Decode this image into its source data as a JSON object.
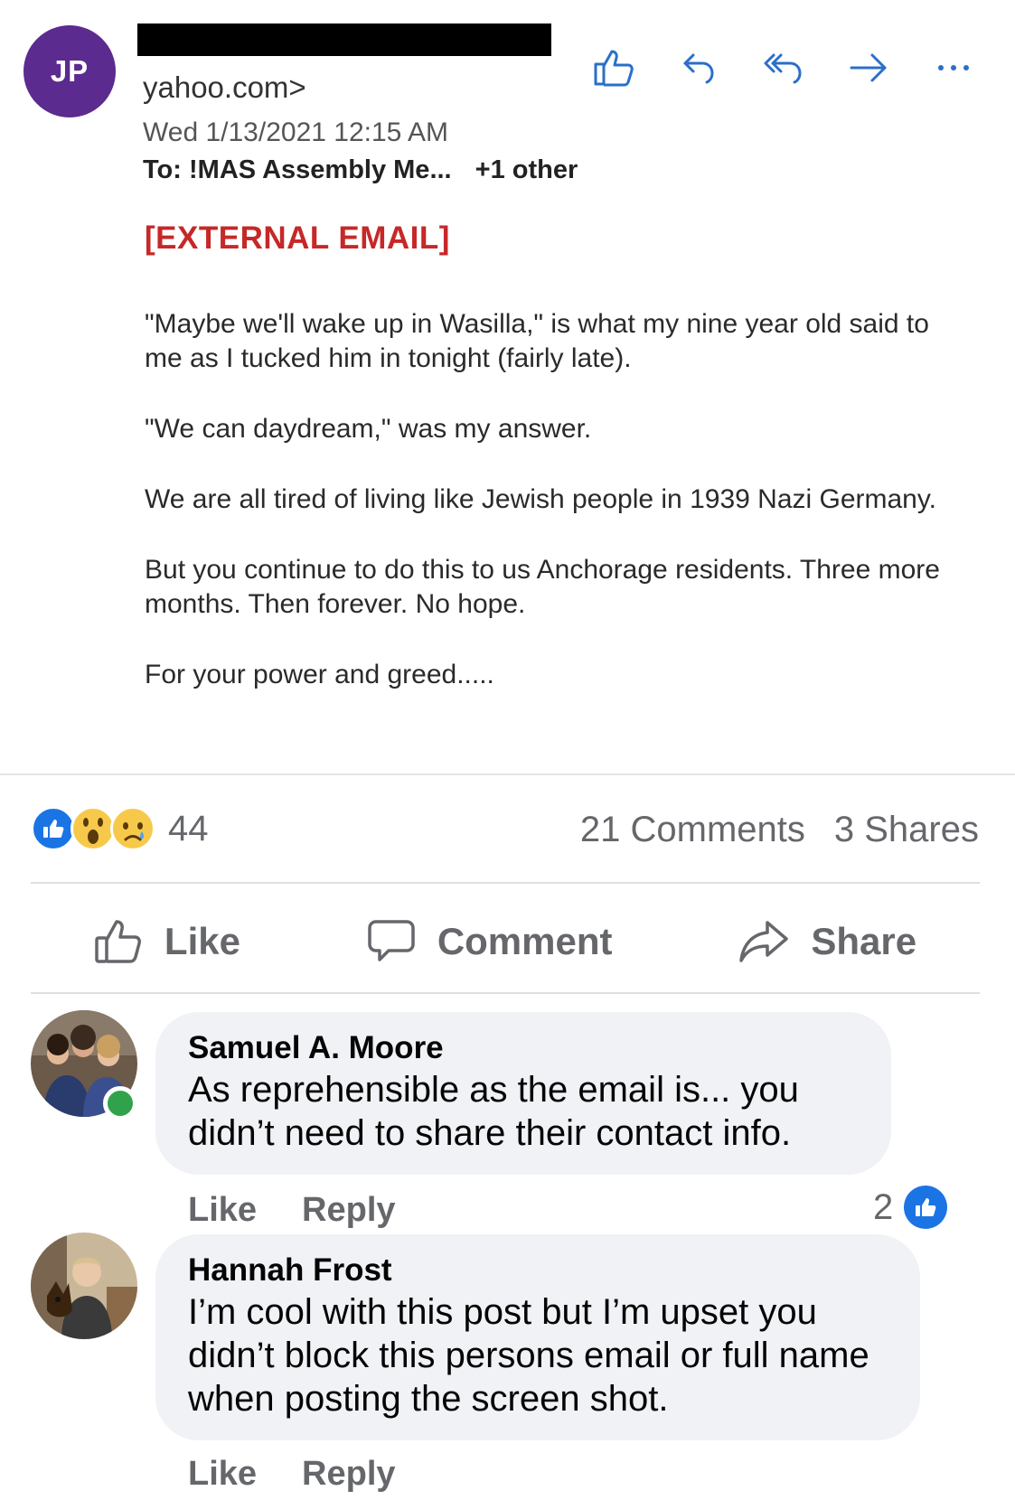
{
  "email": {
    "sender_initials": "JP",
    "sender_domain": "yahoo.com>",
    "date": "Wed 1/13/2021 12:15 AM",
    "to_label": "To:",
    "to_value": "!MAS Assembly Me...",
    "to_other": "+1 other",
    "external_tag": "[EXTERNAL EMAIL]",
    "paragraphs": [
      "\"Maybe we'll wake up in Wasilla,\" is what my nine year old said to me as I tucked him in tonight (fairly late).",
      "\"We can daydream,\" was my answer.",
      "We are all tired of living like Jewish people in 1939 Nazi Germany.",
      "But you continue to do this to us Anchorage residents. Three more months. Then forever. No hope.",
      "For your power and greed....."
    ],
    "actions": [
      "thumbs-up-icon",
      "reply-icon",
      "reply-all-icon",
      "forward-icon",
      "more-icon"
    ]
  },
  "post": {
    "reactions_count": "44",
    "comments_count": "21 Comments",
    "shares_count": "3 Shares",
    "like_label": "Like",
    "comment_label": "Comment",
    "share_label": "Share"
  },
  "comments": [
    {
      "author": "Samuel A. Moore",
      "text": "As reprehensible as the email is... you didn’t need to share their contact info.",
      "like_label": "Like",
      "reply_label": "Reply",
      "likes": "2"
    },
    {
      "author": "Hannah Frost",
      "text": "I’m cool with this post but I’m upset you didn’t block this persons email or full name when posting the screen shot.",
      "like_label": "Like",
      "reply_label": "Reply"
    }
  ],
  "colors": {
    "avatar_purple": "#5b2b8f",
    "external_red": "#c62828",
    "facebook_blue": "#1b74e4",
    "online_green": "#31a24c",
    "muted_gray": "#65676b"
  }
}
